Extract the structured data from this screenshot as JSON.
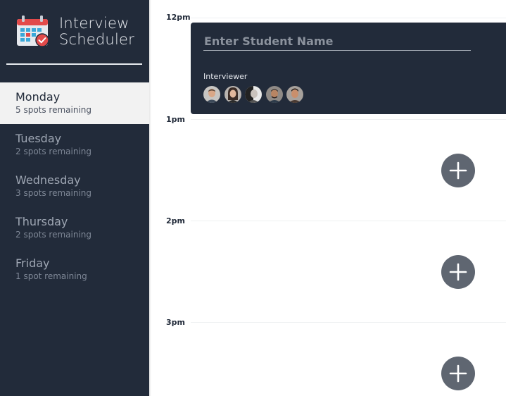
{
  "brand": {
    "title_line1": "Interview",
    "title_line2": "Scheduler"
  },
  "days": [
    {
      "name": "Monday",
      "spots": "5 spots remaining",
      "selected": true
    },
    {
      "name": "Tuesday",
      "spots": "2 spots remaining",
      "selected": false
    },
    {
      "name": "Wednesday",
      "spots": "3 spots remaining",
      "selected": false
    },
    {
      "name": "Thursday",
      "spots": "2 spots remaining",
      "selected": false
    },
    {
      "name": "Friday",
      "spots": "1 spot remaining",
      "selected": false
    }
  ],
  "schedule": {
    "times": [
      "12pm",
      "1pm",
      "2pm",
      "3pm"
    ],
    "form": {
      "student_name_placeholder": "Enter Student Name",
      "student_name_value": "",
      "interviewer_label": "Interviewer",
      "interviewer_avatars": [
        "avatar-1",
        "avatar-2",
        "avatar-3",
        "avatar-4",
        "avatar-5"
      ]
    },
    "add_icon": "plus-icon"
  },
  "colors": {
    "sidebar_bg": "#222b3a",
    "selected_day_bg": "#f2f2f2",
    "add_button": "#5f6671",
    "text_light": "#e6e9ee"
  }
}
